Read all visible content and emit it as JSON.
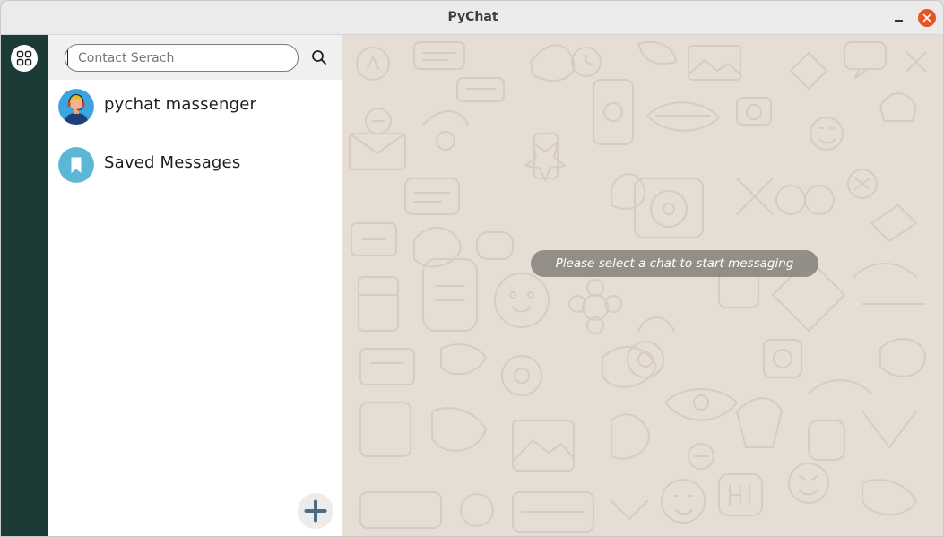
{
  "window": {
    "title": "PyChat",
    "controls": {
      "minimize_icon": "minimize-icon",
      "close_icon": "close-icon"
    }
  },
  "rail": {
    "menu_icon": "grid-menu-icon"
  },
  "search": {
    "value": "",
    "placeholder": "Contact Serach",
    "icon": "search-icon"
  },
  "contacts": [
    {
      "name": "pychat massenger",
      "icon": "support-agent-avatar"
    },
    {
      "name": "Saved Messages",
      "icon": "bookmark-icon"
    }
  ],
  "add_button": {
    "icon": "plus-icon"
  },
  "chat": {
    "empty_hint": "Please select a chat to start messaging"
  },
  "colors": {
    "rail": "#1c3a36",
    "close_button": "#e95420",
    "chat_background": "#e6ddd5",
    "bookmark_avatar": "#5bb7d6",
    "add_icon": "#4a6c86"
  }
}
